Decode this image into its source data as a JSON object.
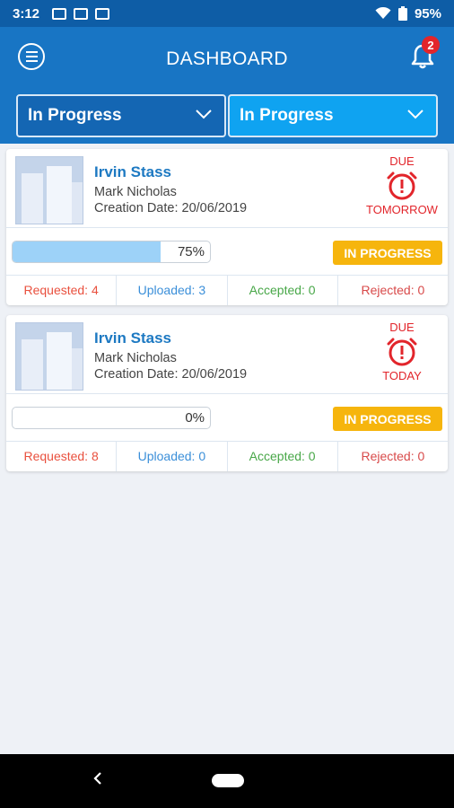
{
  "status_bar": {
    "time": "3:12",
    "battery": "95%"
  },
  "header": {
    "title": "DASHBOARD",
    "notification_count": "2"
  },
  "filters": {
    "left_value": "In Progress",
    "right_value": "In Progress"
  },
  "cards": [
    {
      "name": "Irvin Stass",
      "person": "Mark Nicholas",
      "creation_date": "Creation Date: 20/06/2019",
      "due_label": "DUE",
      "due_when": "TOMORROW",
      "progress_pct": 75,
      "progress_text": "75%",
      "status": "IN PROGRESS",
      "requested": "Requested: 4",
      "uploaded": "Uploaded: 3",
      "accepted": "Accepted: 0",
      "rejected": "Rejected: 0"
    },
    {
      "name": "Irvin Stass",
      "person": "Mark Nicholas",
      "creation_date": "Creation Date: 20/06/2019",
      "due_label": "DUE",
      "due_when": "TODAY",
      "progress_pct": 0,
      "progress_text": "0%",
      "status": "IN PROGRESS",
      "requested": "Requested: 8",
      "uploaded": "Uploaded: 0",
      "accepted": "Accepted: 0",
      "rejected": "Rejected: 0"
    }
  ],
  "icons": {
    "menu": "menu-icon",
    "bell": "bell-icon",
    "chevron": "chevron-down-icon",
    "alarm": "alarm-clock-icon",
    "back": "back-icon",
    "home": "home-pill-icon"
  },
  "colors": {
    "header_blue": "#1875c4",
    "accent_blue": "#0fa3f1",
    "status_orange": "#f6b50d",
    "due_red": "#e2252b"
  }
}
